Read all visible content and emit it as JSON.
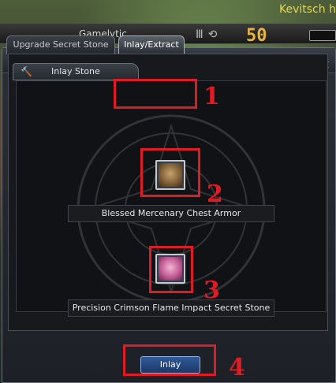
{
  "hud": {
    "player_name": "Kevitsch h",
    "guild_name": "Gamelytic",
    "level": "50",
    "icons": [
      "quest-icon",
      "mail-icon"
    ]
  },
  "window": {
    "close_label": "✕",
    "icon": "crystal-icon"
  },
  "tabs": [
    {
      "label": "Upgrade Secret Stone",
      "active": false
    },
    {
      "label": "Inlay/Extract",
      "active": true
    }
  ],
  "subtab": {
    "label": "Inlay Stone",
    "icon": "hammer-icon"
  },
  "slots": {
    "armor": {
      "label": "Blessed Mercenary Chest Armor",
      "icon": "chest-armor-icon"
    },
    "stone": {
      "label": "Precision Crimson Flame Impact Secret Stone",
      "icon": "secret-stone-icon"
    }
  },
  "action": {
    "inlay_label": "Inlay"
  },
  "markers": [
    "1",
    "2",
    "3",
    "4"
  ],
  "colors": {
    "marker": "#e01b24",
    "button": "#2f5b9a",
    "player_name": "#e8d84a",
    "level": "#e9b43a"
  }
}
